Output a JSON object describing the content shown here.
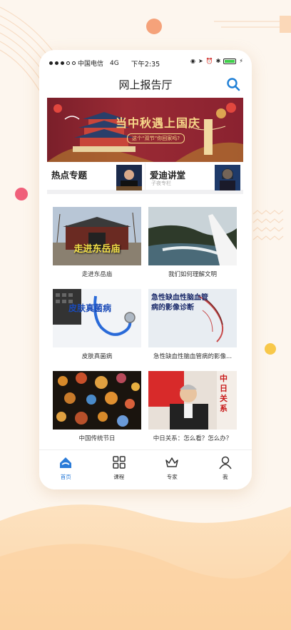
{
  "status_bar": {
    "carrier": "中国电信",
    "network": "4G",
    "time": "下午2:35"
  },
  "nav": {
    "title": "网上报告厅",
    "search_icon": "search-icon"
  },
  "banner": {
    "title": "当中秋遇上国庆",
    "subtitle": "这个“双节”你回家吗?"
  },
  "hot": [
    {
      "label": "热点专题",
      "sub": ""
    },
    {
      "label": "爱迪讲堂",
      "sub": "子夜专栏"
    }
  ],
  "cards": [
    {
      "caption": "走进东岳庙",
      "overlay": "走进东岳庙"
    },
    {
      "caption": "我们如何理解文明",
      "overlay": ""
    },
    {
      "caption": "皮肤真菌病",
      "overlay": "皮肤真菌病"
    },
    {
      "caption": "急性缺血性脑血管病的影像...",
      "overlay": "急性缺血性脑血管病的影像诊断"
    },
    {
      "caption": "中国传统节日",
      "overlay": ""
    },
    {
      "caption": "中日关系：怎么看？怎么办？",
      "overlay": "中日关系"
    }
  ],
  "tabs": [
    {
      "label": "首页",
      "icon": "home-icon",
      "active": true
    },
    {
      "label": "课程",
      "icon": "grid-icon",
      "active": false
    },
    {
      "label": "专家",
      "icon": "crown-icon",
      "active": false
    },
    {
      "label": "我",
      "icon": "user-icon",
      "active": false
    }
  ],
  "colors": {
    "accent": "#2a7bd8",
    "banner": "#8a2230",
    "background": "#fdf6ee"
  }
}
